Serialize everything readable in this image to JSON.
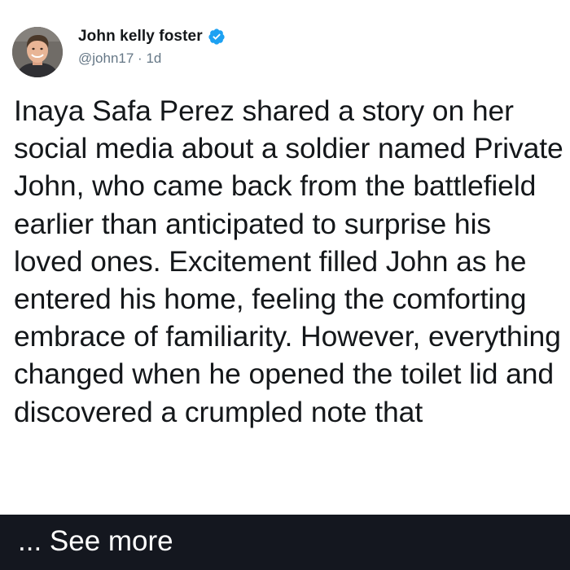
{
  "tweet": {
    "author_name": "John kelly foster",
    "handle": "@john17",
    "separator": "·",
    "timestamp": "1d",
    "verified": true,
    "text": "Inaya Safa Perez shared a story on her social media about a soldier named Private John, who came back from the battlefield earlier than anticipated to surprise his loved ones. Excitement filled John as he entered his home, feeling the comforting embrace of familiarity. However, everything changed when he opened the toilet lid and discovered a crumpled note that"
  },
  "see_more": {
    "label": "... See more"
  },
  "colors": {
    "text": "#14171a",
    "meta": "#657786",
    "verified_badge": "#1da1f2",
    "see_more_background": "#14171f",
    "see_more_text": "#ffffff"
  },
  "icons": {
    "verified": "verified-badge-icon",
    "avatar": "profile-photo"
  }
}
